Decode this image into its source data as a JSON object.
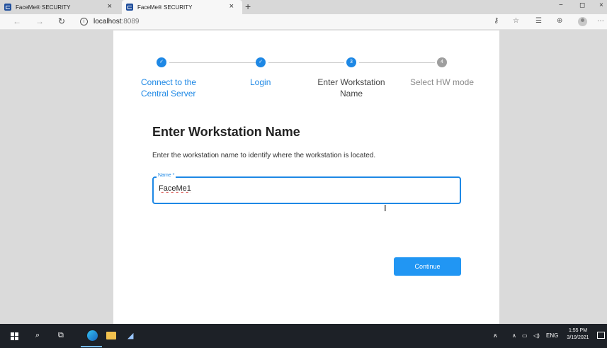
{
  "browser": {
    "tabs": [
      {
        "title": "FaceMe® SECURITY",
        "close": "×"
      },
      {
        "title": "FaceMe® SECURITY",
        "close": "×"
      }
    ],
    "new_tab": "+",
    "window_controls": {
      "minimize": "−",
      "maximize": "◻",
      "close": "×"
    },
    "address": {
      "host": "localhost",
      "port": ":8089"
    },
    "nav": {
      "back": "←",
      "forward": "→",
      "refresh": "↻"
    },
    "more": "···"
  },
  "stepper": {
    "steps": [
      {
        "marker": "✓",
        "label": "Connect to the Central Server",
        "state": "done"
      },
      {
        "marker": "✓",
        "label": "Login",
        "state": "done"
      },
      {
        "marker": "3",
        "label": "Enter Workstation Name",
        "state": "active"
      },
      {
        "marker": "4",
        "label": "Select HW mode",
        "state": "todo"
      }
    ]
  },
  "form": {
    "heading": "Enter Workstation Name",
    "description": "Enter the workstation name to identify where the workstation is located.",
    "name_field": {
      "label": "Name *",
      "value": "FaceMe1"
    },
    "continue_label": "Continue"
  },
  "taskbar": {
    "language": "ENG",
    "time": "1:55 PM",
    "date": "3/19/2021"
  },
  "colors": {
    "accent": "#1e88e5",
    "button": "#2196f3",
    "inactive_step": "#9e9e9e"
  }
}
